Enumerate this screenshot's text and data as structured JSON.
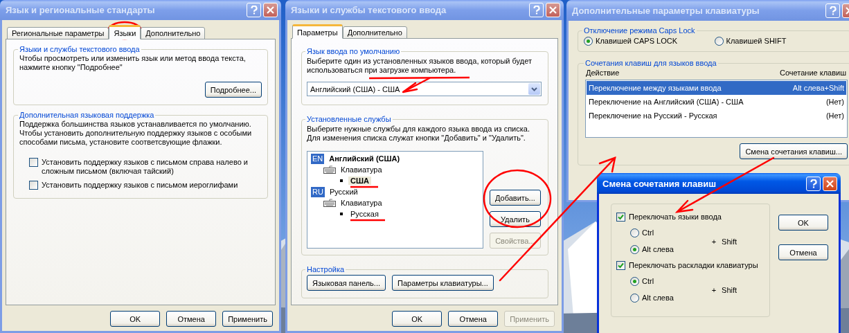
{
  "regional_dialog": {
    "title": "Язык и региональные стандарты",
    "active": false,
    "tabs": [
      {
        "label": "Региональные параметры",
        "selected": false
      },
      {
        "label": "Языки",
        "selected": true
      },
      {
        "label": "Дополнительно",
        "selected": false
      }
    ],
    "text_input_group": {
      "title": "Языки и службы текстового ввода",
      "text": "Чтобы просмотреть или изменить язык или метод ввода текста,\nнажмите кнопку \"Подробнее\"",
      "button": "Подробнее..."
    },
    "support_group": {
      "title": "Дополнительная языковая поддержка",
      "text": "Поддержка большинства языков устанавливается по умолчанию.\nЧтобы установить дополнительную поддержку языков с особыми\nспособами письма, установите соответсвующие флажки.",
      "checkboxes": [
        {
          "label": "Установить поддержку языков с письмом справа налево и\nсложным письмом (включая тайский)",
          "checked": false
        },
        {
          "label": "Установить поддержку языков с письмом иероглифами",
          "checked": false
        }
      ]
    },
    "buttons": [
      {
        "label": "OK",
        "disabled": false
      },
      {
        "label": "Отмена",
        "disabled": false
      },
      {
        "label": "Применить",
        "disabled": false
      }
    ]
  },
  "text_services_dialog": {
    "title": "Языки и службы текстового ввода",
    "active": false,
    "tabs": [
      {
        "label": "Параметры",
        "selected": true
      },
      {
        "label": "Дополнительно",
        "selected": false
      }
    ],
    "default_language_group": {
      "title": "Язык ввода по умолчанию",
      "text": "Выберите один из установленных языков ввода, который будет\nиспользоваться при загрузке компьютера.",
      "value": "Английский (США) - США"
    },
    "services_group": {
      "title": "Установленные службы",
      "text": "Выберите нужные службы для каждого языка ввода из списка.\nДля изменения списка служат кнопки \"Добавить\" и \"Удалить\".",
      "tree": [
        {
          "badge": "EN",
          "label": "Английский (США)",
          "default": true,
          "selected": false,
          "children": [
            {
              "label": "Клавиатура",
              "default": false,
              "selected": false,
              "children": [
                {
                  "label": "США",
                  "default": true,
                  "selected": true
                }
              ]
            }
          ]
        },
        {
          "badge": "RU",
          "label": "Русский",
          "default": false,
          "selected": false,
          "children": [
            {
              "label": "Клавиатура",
              "default": false,
              "selected": false,
              "children": [
                {
                  "label": "Русская",
                  "default": false,
                  "selected": false
                }
              ]
            }
          ]
        }
      ],
      "buttons": [
        {
          "label": "Добавить...",
          "disabled": false
        },
        {
          "label": "Удалить",
          "disabled": false
        },
        {
          "label": "Свойства...",
          "disabled": true
        }
      ]
    },
    "settings_group": {
      "title": "Настройка",
      "buttons": [
        {
          "label": "Языковая панель...",
          "disabled": false
        },
        {
          "label": "Параметры клавиатуры...",
          "disabled": false
        }
      ]
    },
    "buttons": [
      {
        "label": "OK",
        "disabled": false
      },
      {
        "label": "Отмена",
        "disabled": false
      },
      {
        "label": "Применить",
        "disabled": true
      }
    ]
  },
  "keyboard_dialog": {
    "title": "Дополнительные параметры клавиатуры",
    "active": false,
    "caps_group": {
      "title": "Отключение режима Caps Lock",
      "options": [
        {
          "label": "Клавишей CAPS LOCK",
          "selected": true
        },
        {
          "label": "Клавишей SHIFT",
          "selected": false
        }
      ]
    },
    "hotkeys_group": {
      "title": "Сочетания клавиш для языков ввода",
      "columns": [
        "Действие",
        "Сочетание клавиш"
      ],
      "rows": [
        {
          "action": "Переключение между языками ввода",
          "keys": "Alt слева+Shift",
          "selected": true
        },
        {
          "action": "Переключение на Английский (США) - США",
          "keys": "(Нет)",
          "selected": false
        },
        {
          "action": "Переключение на Русский - Русская",
          "keys": "(Нет)",
          "selected": false
        }
      ],
      "button": "Смена сочетания клавиш..."
    }
  },
  "hotkey_dialog": {
    "title": "Смена сочетания клавиш",
    "active": true,
    "settings": [
      {
        "label": "Переключать языки ввода",
        "checked": true,
        "options": [
          {
            "label": "Ctrl",
            "selected": false
          },
          {
            "label": "Alt слева",
            "selected": true
          }
        ],
        "suffix": "+ Shift"
      },
      {
        "label": "Переключать раскладки клавиатуры",
        "checked": true,
        "options": [
          {
            "label": "Ctrl",
            "selected": true
          },
          {
            "label": "Alt слева",
            "selected": false
          }
        ],
        "suffix": "+ Shift"
      }
    ],
    "buttons": [
      {
        "label": "OK",
        "disabled": false
      },
      {
        "label": "Отмена",
        "disabled": false
      }
    ]
  }
}
